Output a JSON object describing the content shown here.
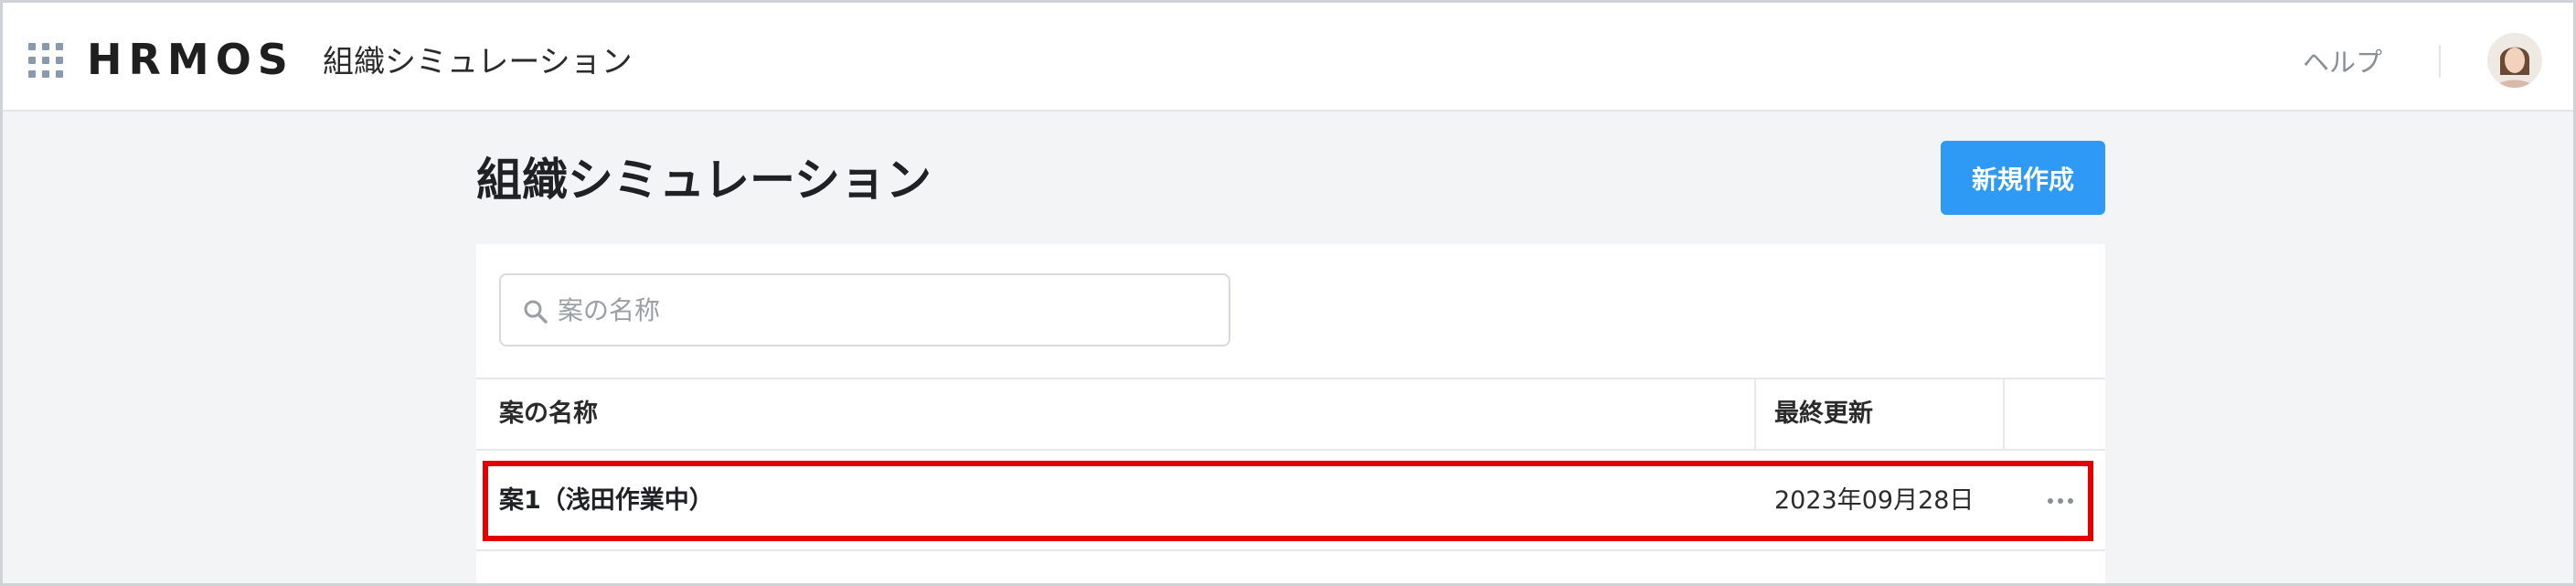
{
  "header": {
    "logo_text": "HRMOS",
    "app_name": "組織シミュレーション",
    "help_label": "ヘルプ"
  },
  "main": {
    "title": "組織シミュレーション",
    "new_button_label": "新規作成",
    "search": {
      "placeholder": "案の名称",
      "value": ""
    },
    "table": {
      "columns": [
        "案の名称",
        "最終更新"
      ],
      "rows": [
        {
          "name": "案1（浅田作業中）",
          "updated": "2023年09月28日"
        }
      ]
    }
  },
  "colors": {
    "accent": "#2f9af5",
    "highlight": "#e20000",
    "background": "#f3f4f6"
  },
  "icons": [
    "app-grid-icon",
    "search-icon",
    "more-horizontal-icon"
  ]
}
